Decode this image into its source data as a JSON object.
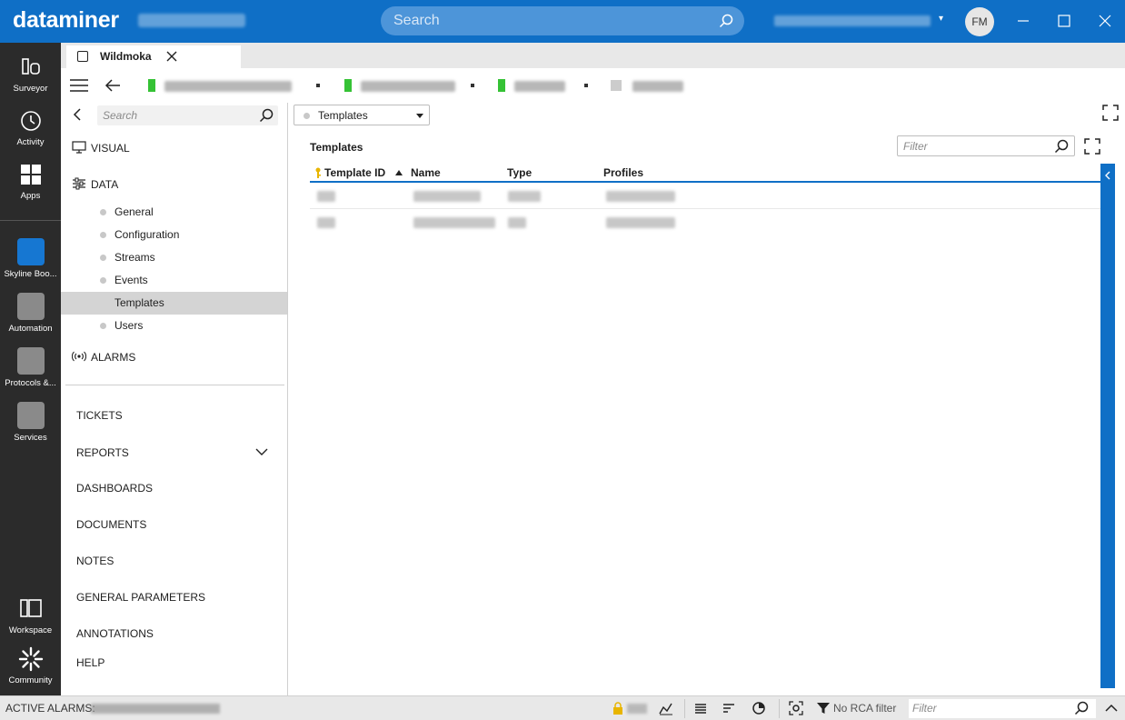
{
  "app": {
    "logo_text": "dataminer",
    "search_placeholder": "Search",
    "user_initials": "FM"
  },
  "rail": [
    {
      "label": "Surveyor",
      "icon": "surveyor-icon"
    },
    {
      "label": "Activity",
      "icon": "activity-icon"
    },
    {
      "label": "Apps",
      "icon": "apps-icon"
    },
    {
      "label": "Skyline Boo...",
      "icon": "booking-icon"
    },
    {
      "label": "Automation",
      "icon": "automation-icon"
    },
    {
      "label": "Protocols &...",
      "icon": "protocols-icon"
    },
    {
      "label": "Services",
      "icon": "services-icon"
    },
    {
      "label": "Workspace",
      "icon": "workspace-icon"
    },
    {
      "label": "Community",
      "icon": "community-icon"
    }
  ],
  "tab": {
    "label": "Wildmoka"
  },
  "side": {
    "search_placeholder": "Search",
    "visual_label": "VISUAL",
    "data_label": "DATA",
    "data_items": [
      "General",
      "Configuration",
      "Streams",
      "Events",
      "Templates",
      "Users"
    ],
    "active_item": "Templates",
    "alarms_label": "ALARMS",
    "modules": [
      "TICKETS",
      "REPORTS",
      "DASHBOARDS",
      "DOCUMENTS",
      "NOTES",
      "GENERAL PARAMETERS",
      "ANNOTATIONS",
      "HELP"
    ]
  },
  "main": {
    "dropdown_value": "Templates",
    "component_title": "Templates",
    "filter_placeholder": "Filter",
    "table": {
      "columns": [
        "Template ID",
        "Name",
        "Type",
        "Profiles"
      ],
      "sorted_column": "Template ID",
      "row_count": 2
    }
  },
  "bottom": {
    "active_alarms_label": "ACTIVE ALARMS:",
    "rca_label": "No RCA filter",
    "filter_placeholder": "Filter"
  },
  "colors": {
    "brand_blue": "#0f6fc6",
    "rail_dark": "#2b2b2b",
    "crumb_green": "#35c235"
  }
}
